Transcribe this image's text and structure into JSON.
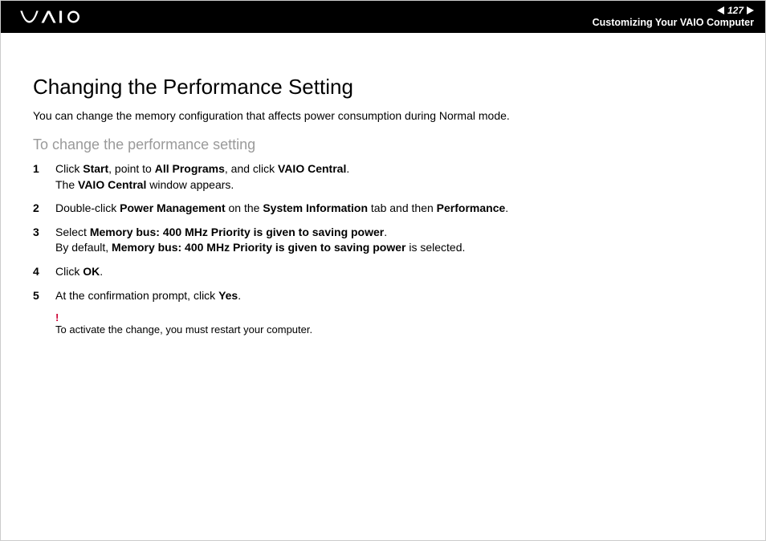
{
  "header": {
    "page_number": "127",
    "section": "Customizing Your VAIO Computer"
  },
  "content": {
    "title": "Changing the Performance Setting",
    "intro": "You can change the memory configuration that affects power consumption during Normal mode.",
    "subtitle": "To change the performance setting",
    "steps": [
      {
        "parts": [
          {
            "t": "Click "
          },
          {
            "t": "Start",
            "b": true
          },
          {
            "t": ", point to "
          },
          {
            "t": "All Programs",
            "b": true
          },
          {
            "t": ", and click "
          },
          {
            "t": "VAIO Central",
            "b": true
          },
          {
            "t": "."
          },
          {
            "br": true
          },
          {
            "t": "The "
          },
          {
            "t": "VAIO Central",
            "b": true
          },
          {
            "t": " window appears."
          }
        ]
      },
      {
        "parts": [
          {
            "t": "Double-click "
          },
          {
            "t": "Power Management",
            "b": true
          },
          {
            "t": " on the "
          },
          {
            "t": "System Information",
            "b": true
          },
          {
            "t": " tab and then "
          },
          {
            "t": "Performance",
            "b": true
          },
          {
            "t": "."
          }
        ]
      },
      {
        "parts": [
          {
            "t": "Select "
          },
          {
            "t": "Memory bus: 400 MHz Priority is given to saving power",
            "b": true
          },
          {
            "t": "."
          },
          {
            "br": true
          },
          {
            "t": "By default, "
          },
          {
            "t": "Memory bus: 400 MHz Priority is given to saving power",
            "b": true
          },
          {
            "t": " is selected."
          }
        ]
      },
      {
        "parts": [
          {
            "t": "Click "
          },
          {
            "t": "OK",
            "b": true
          },
          {
            "t": "."
          }
        ]
      },
      {
        "parts": [
          {
            "t": "At the confirmation prompt, click "
          },
          {
            "t": "Yes",
            "b": true
          },
          {
            "t": "."
          }
        ]
      }
    ],
    "note_mark": "!",
    "note_text": "To activate the change, you must restart your computer."
  }
}
